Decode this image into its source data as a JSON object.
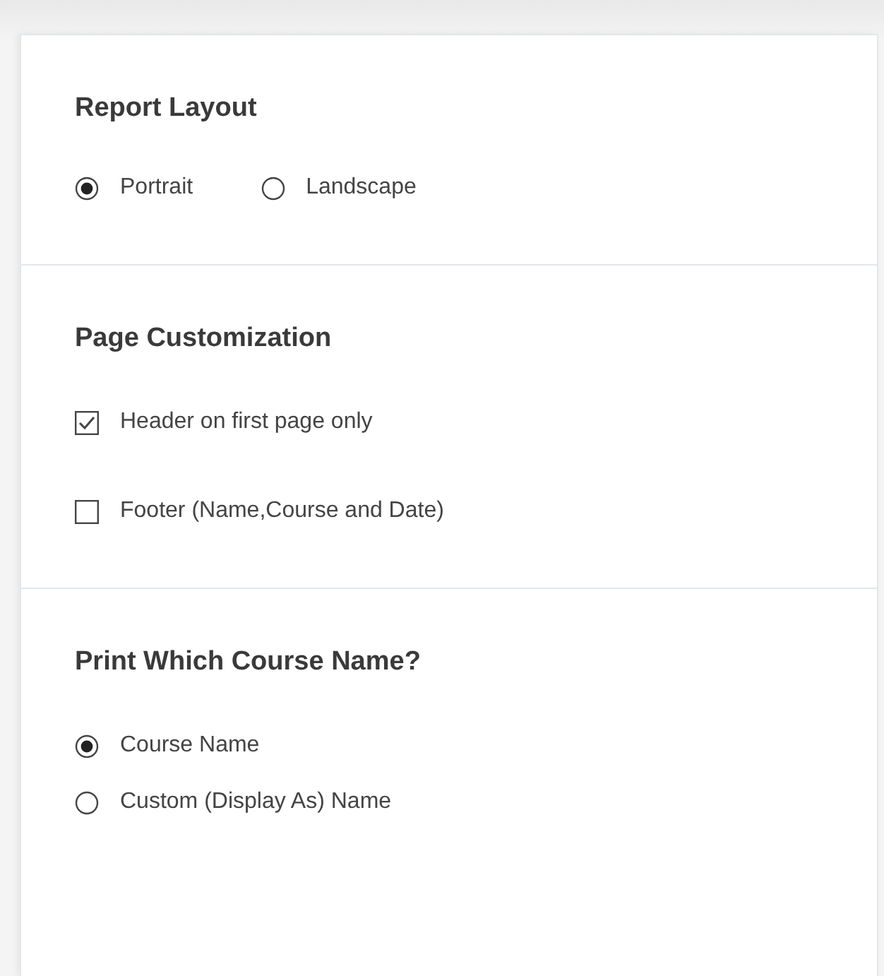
{
  "sections": [
    {
      "title": "Report Layout",
      "kind": "radio-row",
      "options": [
        {
          "label": "Portrait",
          "selected": true
        },
        {
          "label": "Landscape",
          "selected": false
        }
      ]
    },
    {
      "title": "Page Customization",
      "kind": "checkbox-list",
      "options": [
        {
          "label": "Header on first page only",
          "checked": true
        },
        {
          "label": "Footer (Name,Course and Date)",
          "checked": false
        }
      ]
    },
    {
      "title": "Print Which Course Name?",
      "kind": "radio-list",
      "options": [
        {
          "label": "Course Name",
          "selected": true
        },
        {
          "label": "Custom (Display As) Name",
          "selected": false
        }
      ]
    }
  ]
}
